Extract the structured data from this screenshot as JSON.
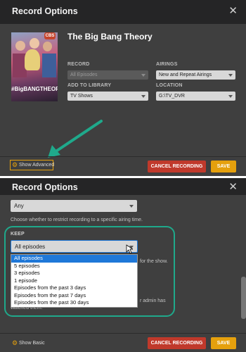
{
  "panel_a": {
    "title": "Record Options",
    "close_icon": "✕",
    "poster_text": "#BigBANGTHEORY",
    "poster_badge": "CBS",
    "show_title": "The Big Bang Theory",
    "record_label": "RECORD",
    "record_value": "All Episodes",
    "airings_label": "AIRINGS",
    "airings_value": "New and Repeat Airings",
    "library_label": "ADD TO LIBRARY",
    "library_value": "TV Shows",
    "location_label": "LOCATION",
    "location_value": "G:\\TV_DVR",
    "advanced_link": "Show Advanced",
    "cancel_label": "CANCEL RECORDING",
    "save_label": "SAVE",
    "accent_color": "#e5a00d",
    "arrow_color": "#1fa98b"
  },
  "panel_b": {
    "title": "Record Options",
    "close_icon": "✕",
    "airtime_value": "Any",
    "airtime_help": "Choose whether to restrict recording to a specific airing time.",
    "keep_label": "KEEP",
    "keep_value": "All episodes",
    "keep_options": [
      "All episodes",
      "5 episodes",
      "3 episodes",
      "1 episode",
      "Episodes from the past 3 days",
      "Episodes from the past 7 days",
      "Episodes from the past 30 days"
    ],
    "keep_selected_index": 0,
    "partial_text_1": "for the show.",
    "partial_text_2": "r admin has",
    "partial_text_3": "watched them.",
    "basic_link": "Show Basic",
    "cancel_label": "CANCEL RECORDING",
    "save_label": "SAVE",
    "highlight_color": "#1fa98b"
  }
}
